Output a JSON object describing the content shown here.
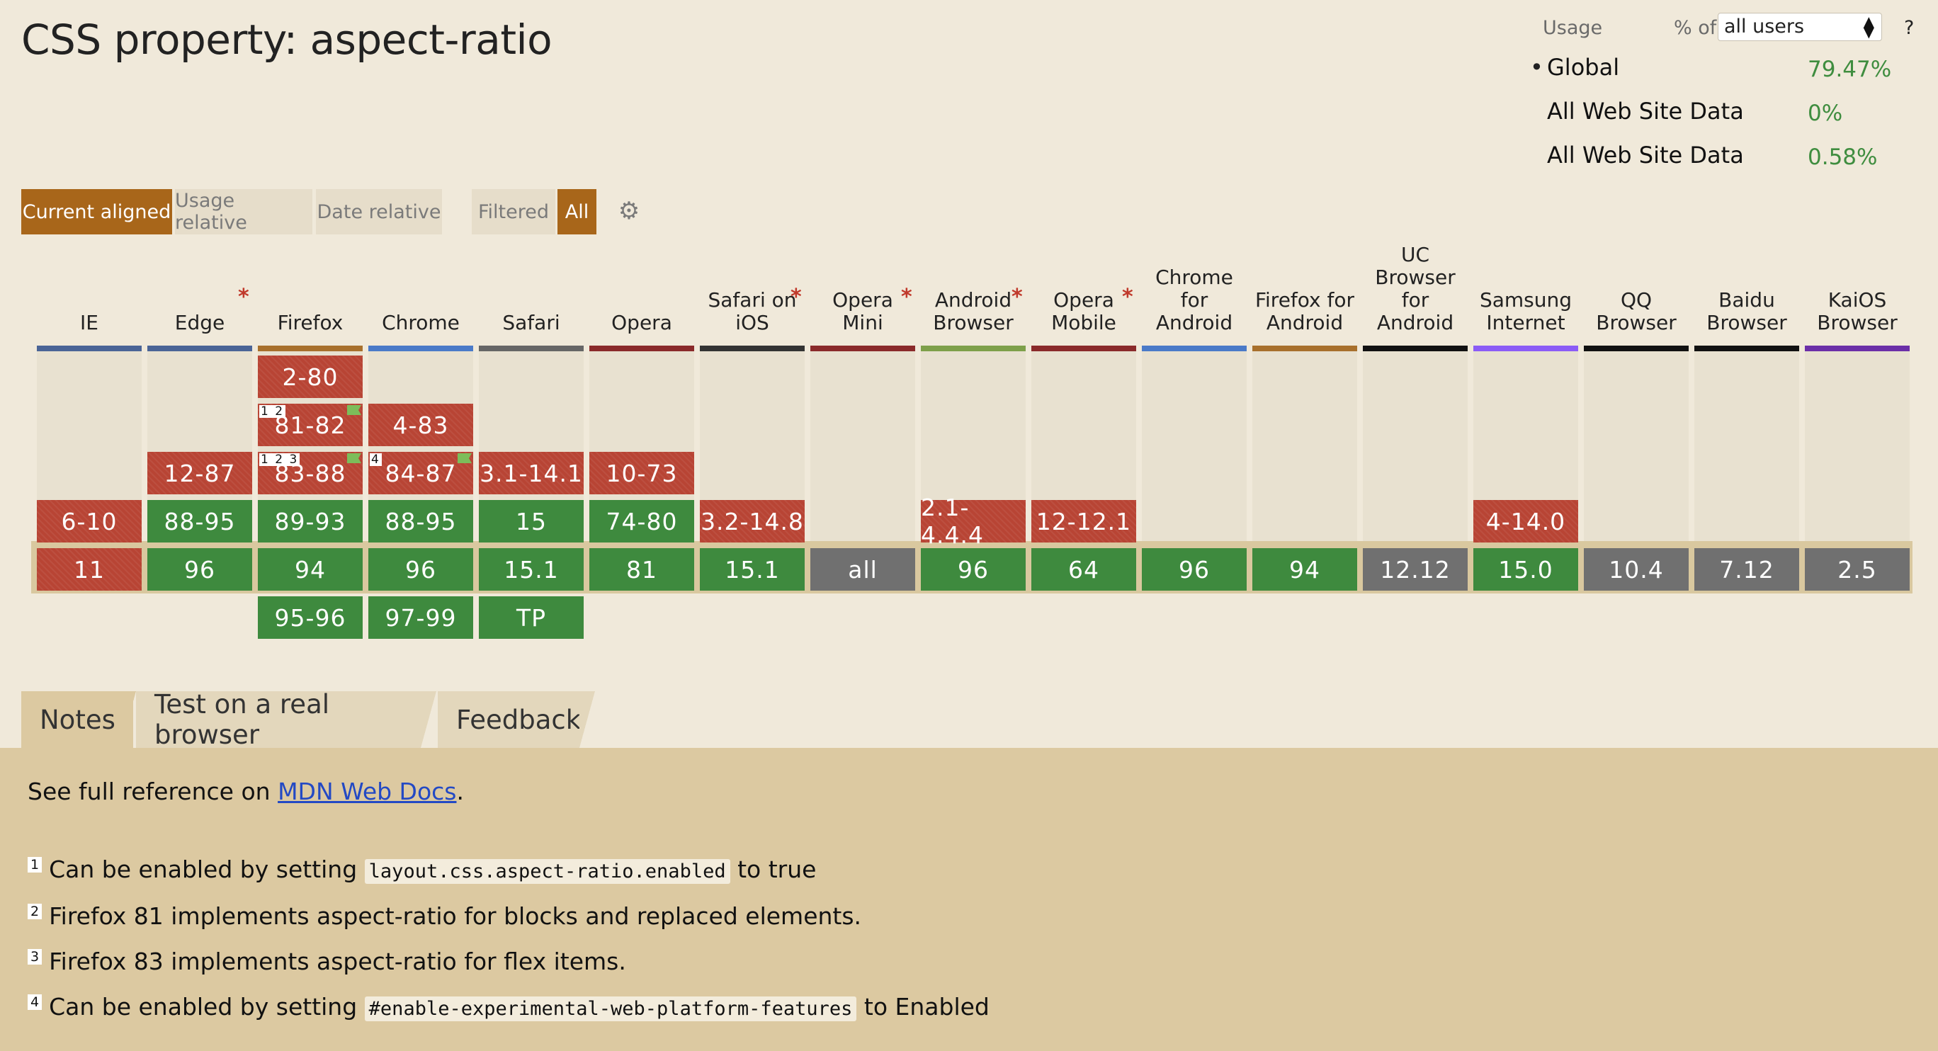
{
  "page_title": "CSS property: aspect-ratio",
  "usage": {
    "label": "Usage",
    "percent_of_label": "% of",
    "select_value": "all users",
    "help": "?",
    "rows": [
      {
        "bullet": "•",
        "name": "Global",
        "value": "79.47%"
      },
      {
        "bullet": "",
        "name": "All Web Site Data",
        "value": "0%"
      },
      {
        "bullet": "",
        "name": "All Web Site Data",
        "value": "0.58%"
      }
    ]
  },
  "toolbar": {
    "current_aligned": "Current aligned",
    "usage_relative": "Usage relative",
    "date_relative": "Date relative",
    "filtered": "Filtered",
    "all": "All",
    "settings_icon": "gear-icon"
  },
  "browsers": [
    {
      "name": "IE",
      "bar": "#4a6496",
      "star": false
    },
    {
      "name": "Edge",
      "bar": "#4a6496",
      "star": true
    },
    {
      "name": "Firefox",
      "bar": "#a8702c",
      "star": false
    },
    {
      "name": "Chrome",
      "bar": "#4a7ac8",
      "star": false
    },
    {
      "name": "Safari",
      "bar": "#666666",
      "star": false
    },
    {
      "name": "Opera",
      "bar": "#8a2a2a",
      "star": false
    },
    {
      "name": "Safari on iOS",
      "bar": "#333333",
      "star": true
    },
    {
      "name": "Opera Mini",
      "bar": "#8a2a2a",
      "star": true
    },
    {
      "name": "Android Browser",
      "bar": "#7ea04a",
      "star": true
    },
    {
      "name": "Opera Mobile",
      "bar": "#8a2a2a",
      "star": true
    },
    {
      "name": "Chrome for Android",
      "bar": "#4a7ac8",
      "star": false
    },
    {
      "name": "Firefox for Android",
      "bar": "#a8702c",
      "star": false
    },
    {
      "name": "UC Browser for Android",
      "bar": "#111111",
      "star": false
    },
    {
      "name": "Samsung Internet",
      "bar": "#8b5cf6",
      "star": false
    },
    {
      "name": "QQ Browser",
      "bar": "#111111",
      "star": false
    },
    {
      "name": "Baidu Browser",
      "bar": "#111111",
      "star": false
    },
    {
      "name": "KaiOS Browser",
      "bar": "#6b2fa8",
      "star": false
    }
  ],
  "cells": [
    {
      "col": 2,
      "row": 0,
      "label": "2-80",
      "status": "n",
      "note": "",
      "flag": false
    },
    {
      "col": 2,
      "row": 1,
      "label": "81-82",
      "status": "n",
      "note": "1 2",
      "flag": true
    },
    {
      "col": 3,
      "row": 1,
      "label": "4-83",
      "status": "n",
      "note": "",
      "flag": false
    },
    {
      "col": 1,
      "row": 2,
      "label": "12-87",
      "status": "n",
      "note": "",
      "flag": false
    },
    {
      "col": 2,
      "row": 2,
      "label": "83-88",
      "status": "n",
      "note": "1 2 3",
      "flag": true
    },
    {
      "col": 3,
      "row": 2,
      "label": "84-87",
      "status": "n",
      "note": "4",
      "flag": true
    },
    {
      "col": 4,
      "row": 2,
      "label": "3.1-14.1",
      "status": "n",
      "note": "",
      "flag": false
    },
    {
      "col": 5,
      "row": 2,
      "label": "10-73",
      "status": "n",
      "note": "",
      "flag": false
    },
    {
      "col": 0,
      "row": 3,
      "label": "6-10",
      "status": "n",
      "note": "",
      "flag": false
    },
    {
      "col": 1,
      "row": 3,
      "label": "88-95",
      "status": "y",
      "note": "",
      "flag": false
    },
    {
      "col": 2,
      "row": 3,
      "label": "89-93",
      "status": "y",
      "note": "",
      "flag": false
    },
    {
      "col": 3,
      "row": 3,
      "label": "88-95",
      "status": "y",
      "note": "",
      "flag": false
    },
    {
      "col": 4,
      "row": 3,
      "label": "15",
      "status": "y",
      "note": "",
      "flag": false
    },
    {
      "col": 5,
      "row": 3,
      "label": "74-80",
      "status": "y",
      "note": "",
      "flag": false
    },
    {
      "col": 6,
      "row": 3,
      "label": "3.2-14.8",
      "status": "n",
      "note": "",
      "flag": false
    },
    {
      "col": 8,
      "row": 3,
      "label": "2.1-4.4.4",
      "status": "n",
      "note": "",
      "flag": false
    },
    {
      "col": 9,
      "row": 3,
      "label": "12-12.1",
      "status": "n",
      "note": "",
      "flag": false
    },
    {
      "col": 13,
      "row": 3,
      "label": "4-14.0",
      "status": "n",
      "note": "",
      "flag": false
    },
    {
      "col": 0,
      "row": 4,
      "label": "11",
      "status": "n",
      "note": "",
      "flag": false
    },
    {
      "col": 1,
      "row": 4,
      "label": "96",
      "status": "y",
      "note": "",
      "flag": false
    },
    {
      "col": 2,
      "row": 4,
      "label": "94",
      "status": "y",
      "note": "",
      "flag": false
    },
    {
      "col": 3,
      "row": 4,
      "label": "96",
      "status": "y",
      "note": "",
      "flag": false
    },
    {
      "col": 4,
      "row": 4,
      "label": "15.1",
      "status": "y",
      "note": "",
      "flag": false
    },
    {
      "col": 5,
      "row": 4,
      "label": "81",
      "status": "y",
      "note": "",
      "flag": false
    },
    {
      "col": 6,
      "row": 4,
      "label": "15.1",
      "status": "y",
      "note": "",
      "flag": false
    },
    {
      "col": 7,
      "row": 4,
      "label": "all",
      "status": "u",
      "note": "",
      "flag": false
    },
    {
      "col": 8,
      "row": 4,
      "label": "96",
      "status": "y",
      "note": "",
      "flag": false
    },
    {
      "col": 9,
      "row": 4,
      "label": "64",
      "status": "y",
      "note": "",
      "flag": false
    },
    {
      "col": 10,
      "row": 4,
      "label": "96",
      "status": "y",
      "note": "",
      "flag": false
    },
    {
      "col": 11,
      "row": 4,
      "label": "94",
      "status": "y",
      "note": "",
      "flag": false
    },
    {
      "col": 12,
      "row": 4,
      "label": "12.12",
      "status": "u",
      "note": "",
      "flag": false
    },
    {
      "col": 13,
      "row": 4,
      "label": "15.0",
      "status": "y",
      "note": "",
      "flag": false
    },
    {
      "col": 14,
      "row": 4,
      "label": "10.4",
      "status": "u",
      "note": "",
      "flag": false
    },
    {
      "col": 15,
      "row": 4,
      "label": "7.12",
      "status": "u",
      "note": "",
      "flag": false
    },
    {
      "col": 16,
      "row": 4,
      "label": "2.5",
      "status": "u",
      "note": "",
      "flag": false
    },
    {
      "col": 2,
      "row": 5,
      "label": "95-96",
      "status": "y",
      "note": "",
      "flag": false
    },
    {
      "col": 3,
      "row": 5,
      "label": "97-99",
      "status": "y",
      "note": "",
      "flag": false
    },
    {
      "col": 4,
      "row": 5,
      "label": "TP",
      "status": "y",
      "note": "",
      "flag": false
    }
  ],
  "tabs": {
    "notes": "Notes",
    "test": "Test on a real browser",
    "feedback": "Feedback"
  },
  "notes": {
    "mdn_prefix": "See full reference on ",
    "mdn_link": "MDN Web Docs",
    "mdn_suffix": ".",
    "items": [
      {
        "num": "1",
        "pre": "Can be enabled by setting ",
        "code": "layout.css.aspect-ratio.enabled",
        "post": " to true"
      },
      {
        "num": "2",
        "pre": "Firefox 81 implements aspect-ratio for blocks and replaced elements.",
        "code": "",
        "post": ""
      },
      {
        "num": "3",
        "pre": "Firefox 83 implements aspect-ratio for flex items.",
        "code": "",
        "post": ""
      },
      {
        "num": "4",
        "pre": "Can be enabled by setting ",
        "code": "#enable-experimental-web-platform-features",
        "post": " to Enabled"
      }
    ]
  },
  "colors": {
    "unsupported": "#b84434",
    "supported": "#3e8a3e",
    "unknown": "#707070",
    "accent": "#a8661a"
  }
}
